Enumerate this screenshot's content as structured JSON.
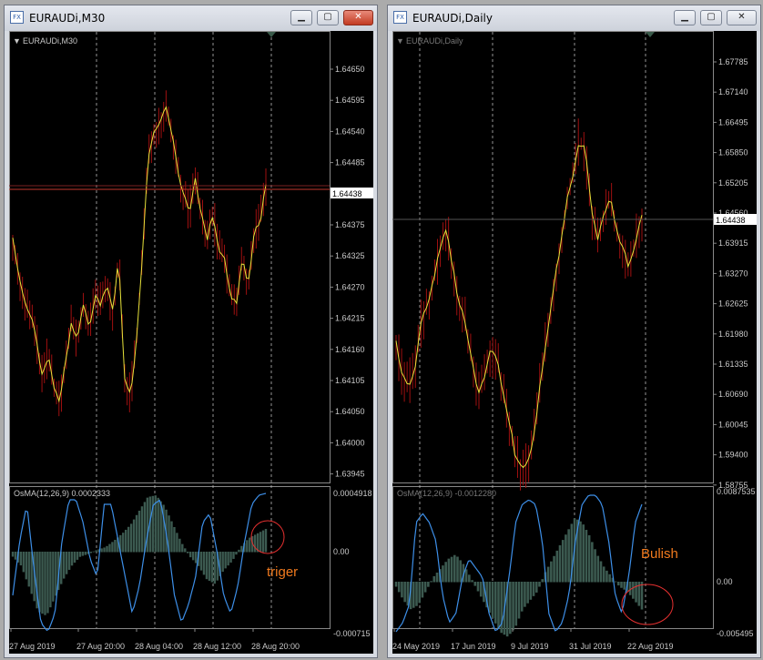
{
  "windows": [
    {
      "title": "EURAUDi,M30",
      "chart_label": "EURAUDi,M30",
      "price_ticks": [
        "1.64650",
        "1.64595",
        "1.64540",
        "1.64485",
        "1.64430",
        "1.64375",
        "1.64325",
        "1.64270",
        "1.64215",
        "1.64160",
        "1.64105",
        "1.64050",
        "1.64000",
        "1.63945"
      ],
      "current_price": "1.64438",
      "osc_label": "OsMA(12,26,9) 0.0002333",
      "osc_ticks": [
        "0.0004918",
        "0.00",
        "-0.000715"
      ],
      "time_ticks": [
        "27 Aug 2019",
        "27 Aug 20:00",
        "28 Aug 04:00",
        "28 Aug 12:00",
        "28 Aug 20:00"
      ],
      "annotation": "triger"
    },
    {
      "title": "EURAUDi,Daily",
      "chart_label": "EURAUDi,Daily",
      "price_ticks": [
        "1.67785",
        "1.67140",
        "1.66495",
        "1.65850",
        "1.65205",
        "1.64560",
        "1.63915",
        "1.63270",
        "1.62625",
        "1.61980",
        "1.61335",
        "1.60690",
        "1.60045",
        "1.59400",
        "1.58755"
      ],
      "current_price": "1.64438",
      "osc_label": "OsMA(12,26,9) -0.0012280",
      "osc_ticks": [
        "0.0087535",
        "0.00",
        "-0.005495"
      ],
      "time_ticks": [
        "24 May 2019",
        "17 Jun 2019",
        "9 Jul 2019",
        "31 Jul 2019",
        "22 Aug 2019"
      ],
      "annotation": "Bulish"
    }
  ],
  "colors": {
    "background": "#000000",
    "candle": "#a01010",
    "price_line": "#e6e23a",
    "histogram": "#3c5a50",
    "signal_line": "#3d8fe8",
    "axis_text": "#c8c8c8",
    "annotation": "#f07a1e",
    "grid_dash": "#bbbbbb"
  }
}
